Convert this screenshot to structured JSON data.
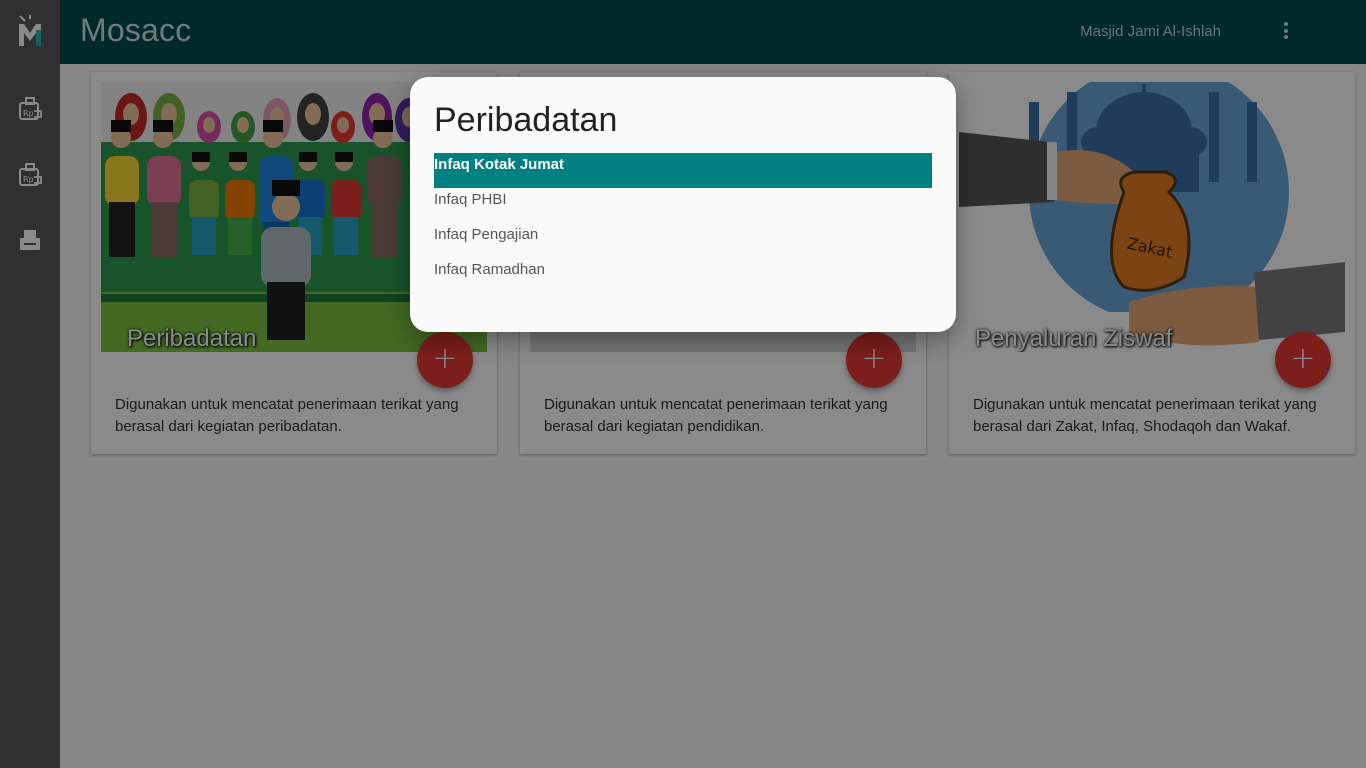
{
  "app": {
    "title": "Mosacc",
    "org_name": "Masjid Jami Al-Ishlah"
  },
  "sidebar": {
    "items": [
      {
        "icon": "donation-box-icon"
      },
      {
        "icon": "donation-box-icon"
      },
      {
        "icon": "printer-icon"
      }
    ]
  },
  "cards": [
    {
      "title": "Peribadatan",
      "description": "Digunakan untuk mencatat penerimaan terikat yang berasal dari kegiatan peribadatan.",
      "fab_label": "+"
    },
    {
      "title": "",
      "description": "Digunakan untuk mencatat penerimaan terikat yang berasal dari kegiatan pendidikan.",
      "fab_label": "+"
    },
    {
      "title": "Penyaluran Ziswaf",
      "description": "Digunakan untuk mencatat penerimaan terikat yang berasal dari Zakat, Infaq, Shodaqoh dan Wakaf.",
      "fab_label": "+",
      "bag_label": "Zakat"
    }
  ],
  "dialog": {
    "title": "Peribadatan",
    "items": [
      {
        "label": "Infaq Kotak Jumat",
        "selected": true
      },
      {
        "label": "Infaq PHBI",
        "selected": false
      },
      {
        "label": "Infaq Pengajian",
        "selected": false
      },
      {
        "label": "Infaq Ramadhan",
        "selected": false
      }
    ]
  },
  "colors": {
    "topbar": "#004d4d",
    "rail": "#5a5a5a",
    "accent": "#008080",
    "fab": "#e53935"
  }
}
